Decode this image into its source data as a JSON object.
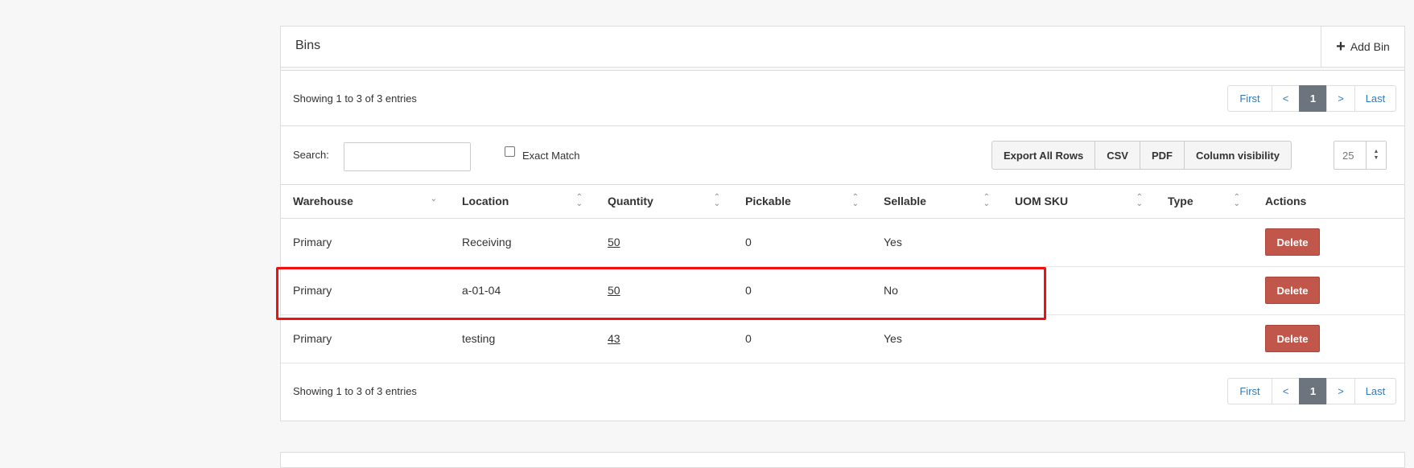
{
  "panel": {
    "title": "Bins",
    "add_label": "Add Bin"
  },
  "info": {
    "top": "Showing 1 to 3 of 3 entries",
    "bottom": "Showing 1 to 3 of 3 entries"
  },
  "pagination": {
    "first": "First",
    "prev": "<",
    "current": "1",
    "next": ">",
    "last": "Last"
  },
  "search": {
    "label": "Search:",
    "value": "",
    "exact_match_label": "Exact Match",
    "exact_match_checked": false
  },
  "toolbar": {
    "export_all": "Export All Rows",
    "csv": "CSV",
    "pdf": "PDF",
    "column_visibility": "Column visibility",
    "page_length": "25"
  },
  "table": {
    "columns": [
      "Warehouse",
      "Location",
      "Quantity",
      "Pickable",
      "Sellable",
      "UOM SKU",
      "Type",
      "Actions"
    ],
    "rows": [
      {
        "warehouse": "Primary",
        "location": "Receiving",
        "quantity": "50",
        "pickable": "0",
        "sellable": "Yes",
        "uom_sku": "",
        "type": "",
        "action": "Delete"
      },
      {
        "warehouse": "Primary",
        "location": "a-01-04",
        "quantity": "50",
        "pickable": "0",
        "sellable": "No",
        "uom_sku": "",
        "type": "",
        "action": "Delete"
      },
      {
        "warehouse": "Primary",
        "location": "testing",
        "quantity": "43",
        "pickable": "0",
        "sellable": "Yes",
        "uom_sku": "",
        "type": "",
        "action": "Delete"
      }
    ]
  },
  "colors": {
    "delete_button": "#c0574a",
    "highlight": "#ee1111",
    "active_page": "#6c757d",
    "link": "#337ab7"
  }
}
